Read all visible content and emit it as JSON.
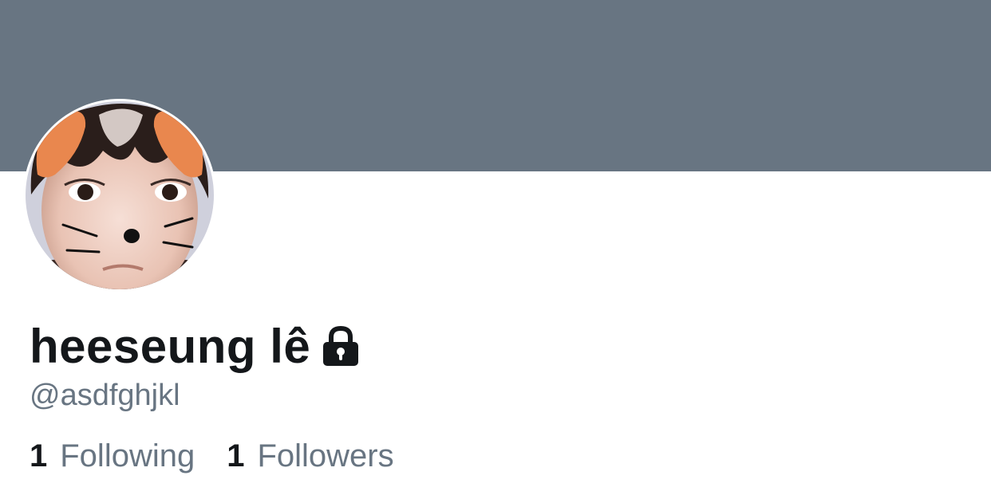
{
  "profile": {
    "display_name": "heeseung lê",
    "handle": "@asdfghjkl",
    "protected_icon": "lock-icon",
    "avatar_icon": "profile-photo"
  },
  "stats": {
    "following_count": "1",
    "following_label": "Following",
    "followers_count": "1",
    "followers_label": "Followers"
  },
  "colors": {
    "banner": "#687582",
    "text_primary": "#14171a",
    "text_secondary": "#687582"
  }
}
